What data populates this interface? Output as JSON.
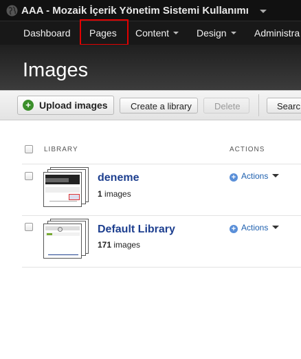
{
  "site": {
    "title": "AAA - Mozaik İçerik Yönetim Sistemi Kullanımı"
  },
  "nav": [
    {
      "label": "Dashboard"
    },
    {
      "label": "Pages"
    },
    {
      "label": "Content"
    },
    {
      "label": "Design"
    },
    {
      "label": "Administra"
    }
  ],
  "page": {
    "title": "Images"
  },
  "toolbar": {
    "upload_label": "Upload images",
    "create_label": "Create a library",
    "delete_label": "Delete",
    "search_label": "Searc"
  },
  "table": {
    "columns": [
      "LIBRARY",
      "ACTIONS"
    ],
    "rows": [
      {
        "name": "deneme",
        "count": "1",
        "count_unit": "images",
        "action": "Actions"
      },
      {
        "name": "Default Library",
        "count": "171",
        "count_unit": "images",
        "action": "Actions"
      }
    ]
  },
  "colors": {
    "highlight": "#e20000",
    "link": "#1d3f8f",
    "accent_green": "#3b8f2b"
  }
}
